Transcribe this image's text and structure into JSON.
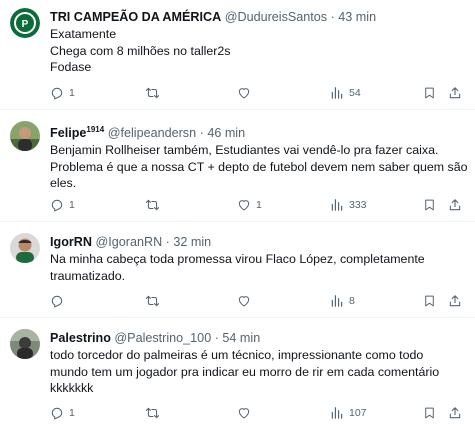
{
  "tweets": [
    {
      "name": "TRI CAMPEÃO DA AMÉRICA",
      "verified": "",
      "handle": "@DudureisSantos",
      "dot": "·",
      "time": "43 min",
      "lines": [
        "Exatamente",
        "Chega com 8 milhões no taller2s",
        "Fodase"
      ],
      "reply_count": "1",
      "retweet_count": "",
      "like_count": "",
      "views_count": "54"
    },
    {
      "name": "Felipe",
      "verified": "1914",
      "handle": "@felipeandersn",
      "dot": "·",
      "time": "46 min",
      "lines": [
        "Benjamin Rollheiser também, Estudiantes vai vendê-lo pra fazer caixa.",
        "Problema é que a nossa CT + depto de futebol devem nem saber quem são",
        "eles."
      ],
      "reply_count": "1",
      "retweet_count": "",
      "like_count": "1",
      "views_count": "333"
    },
    {
      "name": "IgorRN",
      "verified": "",
      "handle": "@IgoranRN",
      "dot": "·",
      "time": "32 min",
      "lines": [
        "Na minha cabeça toda promessa virou Flaco López, completamente",
        "traumatizado."
      ],
      "reply_count": "",
      "retweet_count": "",
      "like_count": "",
      "views_count": "8"
    },
    {
      "name": "Palestrino",
      "verified": "",
      "handle": "@Palestrino_100",
      "dot": "·",
      "time": "54 min",
      "lines": [
        "todo torcedor do palmeiras é um técnico, impressionante como todo",
        "mundo tem um jogador pra indicar eu morro de rir em cada comentário",
        "kkkkkkk"
      ],
      "reply_count": "1",
      "retweet_count": "",
      "like_count": "",
      "views_count": "107"
    }
  ],
  "icons": {
    "reply": "reply-icon",
    "retweet": "retweet-icon",
    "like": "heart-icon",
    "views": "views-icon",
    "bookmark": "bookmark-icon",
    "share": "share-icon"
  },
  "colors": {
    "text": "#0f1419",
    "secondary": "#536471",
    "divider": "#eff3f4"
  }
}
